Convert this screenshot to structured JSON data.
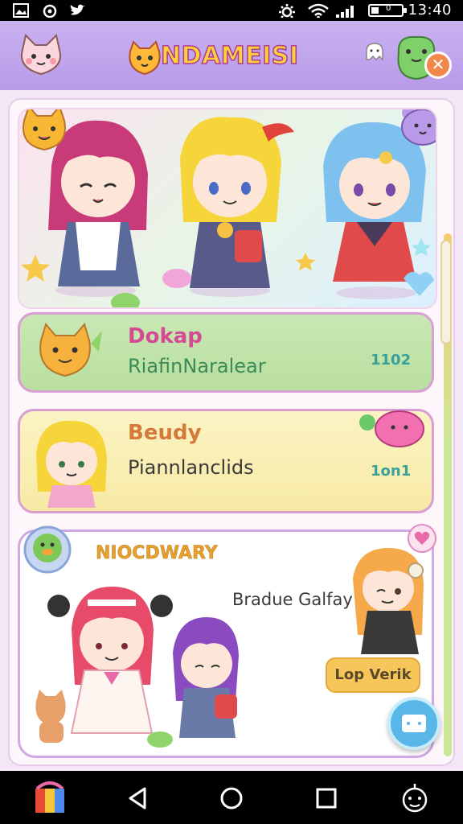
{
  "status_bar": {
    "time": "13:40",
    "battery_label": "0",
    "battery_level": 0.25,
    "icons": [
      "gallery-icon",
      "sync-icon",
      "twitter-icon",
      "settings-icon",
      "wifi-icon",
      "signal-icon",
      "battery-icon"
    ]
  },
  "header": {
    "brand": "NDAMEISI",
    "icons": [
      "cat-pet-icon",
      "ghost-icon",
      "frog-pet-icon",
      "close-icon"
    ],
    "close_symbol": "✕"
  },
  "cards": [
    {
      "title": "Dokap",
      "subtitle": "RiafinNaralear",
      "count": "1102",
      "title_color": "#d54a95"
    },
    {
      "title": "Beudy",
      "subtitle": "Piannlanclids",
      "count": "1on1",
      "title_color": "#d47a3a"
    },
    {
      "title": "NIOCDWARY",
      "subtitle": "Bradue Galfay",
      "action": "Lop Verik",
      "title_color": "#e8a02c"
    }
  ],
  "nav": {
    "icons": [
      "app-store-icon",
      "back-icon",
      "home-icon",
      "recents-icon",
      "robot-icon"
    ]
  },
  "colors": {
    "accent": "#b89ae8",
    "green_card": "#c9e8b4",
    "yellow_card": "#fbf3c4",
    "button": "#f6c65a"
  }
}
